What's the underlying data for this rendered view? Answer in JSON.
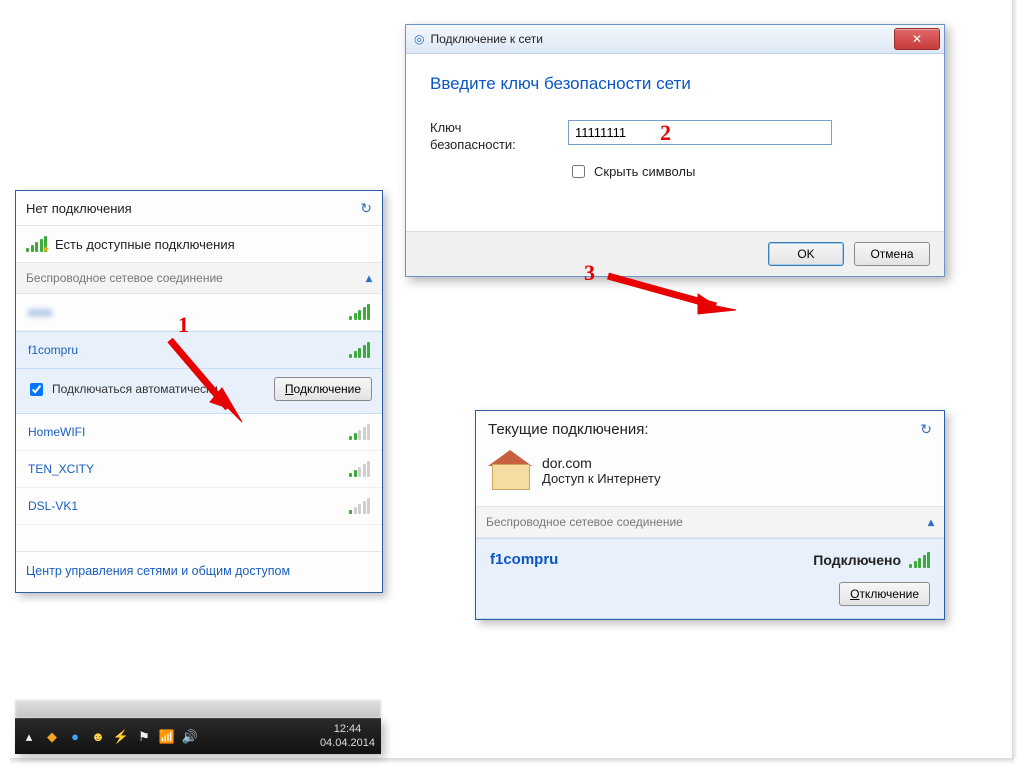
{
  "annotations": {
    "n1": "1",
    "n2": "2",
    "n3": "3"
  },
  "flyout": {
    "title": "Нет подключения",
    "available": "Есть доступные подключения",
    "group": "Беспроводное сетевое соединение",
    "hidden_first": "xxxx",
    "selected": "f1compru",
    "auto_label": "Подключаться автоматически",
    "connect_btn": "Подключение",
    "connect_btn_u": "П",
    "nets": [
      "HomeWIFI",
      "TEN_XCITY",
      "DSL-VK1"
    ],
    "footer": "Центр управления сетями и общим доступом"
  },
  "taskbar": {
    "time": "12:44",
    "date": "04.04.2014"
  },
  "dialog": {
    "title": "Подключение к сети",
    "heading": "Введите ключ безопасности сети",
    "key_label": "Ключ безопасности:",
    "key_value": "11111111",
    "hide_label": "Скрыть символы",
    "ok": "OK",
    "cancel": "Отмена"
  },
  "flyout2": {
    "title": "Текущие подключения:",
    "home_name": "dor.com",
    "home_desc": "Доступ к Интернету",
    "group": "Беспроводное сетевое соединение",
    "net": "f1compru",
    "status": "Подключено",
    "disconnect": "Отключение",
    "disconnect_u": "О"
  }
}
